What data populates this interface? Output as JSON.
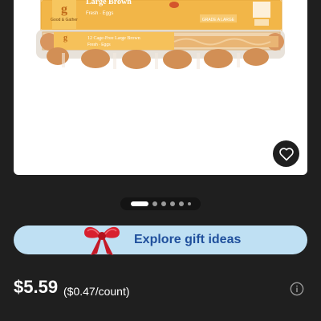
{
  "product_image": {
    "brand": "Good & Gather",
    "lid_title": "Large Brown",
    "lid_sub": "Fresh · Eggs",
    "lid_grade": "GRADE A LARGE",
    "carton_text": "12 Cage-Free Large Brown",
    "carton_sub": "Fresh · Eggs"
  },
  "carousel": {
    "total": 6,
    "active_index": 0
  },
  "gift_banner": {
    "label": "Explore gift ideas"
  },
  "pricing": {
    "price": "$5.59",
    "unit_price": "($0.47/count)"
  },
  "colors": {
    "background": "#1f1f1f",
    "gift_bar": "#bfe0f3",
    "gift_text": "#1f4f9c"
  },
  "icons": [
    "heart-icon",
    "bow-icon",
    "info-icon"
  ]
}
